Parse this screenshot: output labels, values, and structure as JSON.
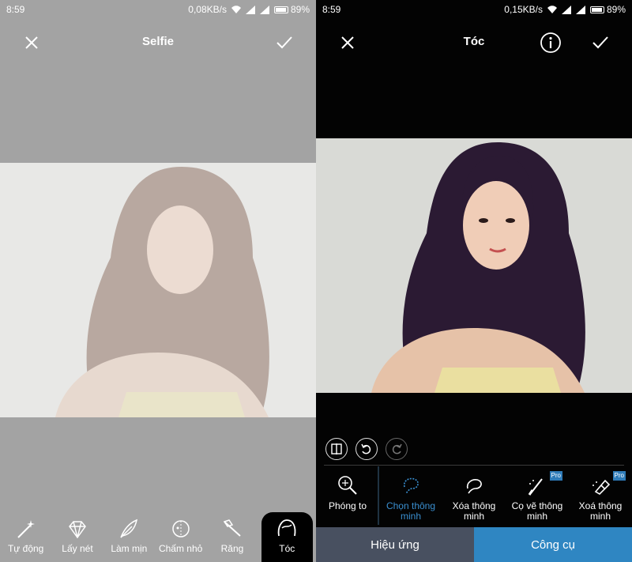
{
  "left": {
    "status": {
      "time": "8:59",
      "speed": "0,08KB/s",
      "battery": "89%"
    },
    "title": "Selfie",
    "tools": [
      {
        "label": "Tự động",
        "icon": "magic-wand-icon"
      },
      {
        "label": "Lấy nét",
        "icon": "diamond-icon"
      },
      {
        "label": "Làm mịn",
        "icon": "feather-icon"
      },
      {
        "label": "Chấm nhỏ",
        "icon": "spot-icon"
      },
      {
        "label": "Răng",
        "icon": "toothbrush-icon"
      },
      {
        "label": "Tóc",
        "icon": "hair-icon"
      }
    ]
  },
  "right": {
    "status": {
      "time": "8:59",
      "speed": "0,15KB/s",
      "battery": "89%"
    },
    "title": "Tóc",
    "tools": [
      {
        "label": "Phóng to",
        "icon": "zoom-icon",
        "pro": false
      },
      {
        "label": "Chọn thông minh",
        "icon": "smart-select-icon",
        "pro": false
      },
      {
        "label": "Xóa thông minh",
        "icon": "smart-erase-icon",
        "pro": false
      },
      {
        "label": "Cọ vẽ thông minh",
        "icon": "smart-brush-icon",
        "pro": true
      },
      {
        "label": "Xoá thông minh",
        "icon": "eraser-icon",
        "pro": true
      }
    ],
    "pro_badge": "Pro",
    "tabs": {
      "effects": "Hiệu ứng",
      "tools": "Công cụ"
    }
  },
  "colors": {
    "accent": "#2f86c2",
    "active_tool": "#3a8fd0",
    "effects_tab": "#485060"
  }
}
